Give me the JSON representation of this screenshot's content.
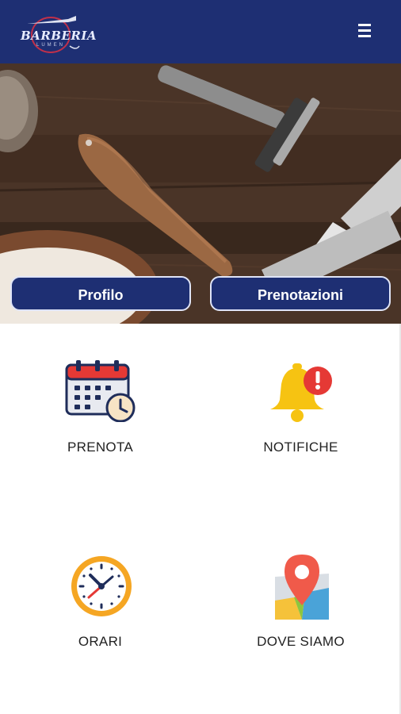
{
  "header": {
    "logo_text": "BARBERIA",
    "logo_sub": "LUMEN",
    "menu_icon": "hamburger-menu-icon"
  },
  "hero": {
    "profile_button": "Profilo",
    "bookings_button": "Prenotazioni"
  },
  "tiles": [
    {
      "label": "PRENOTA",
      "icon": "calendar-clock-icon"
    },
    {
      "label": "NOTIFICHE",
      "icon": "bell-alert-icon"
    },
    {
      "label": "ORARI",
      "icon": "clock-icon"
    },
    {
      "label": "DOVE SIAMO",
      "icon": "map-pin-icon"
    }
  ],
  "colors": {
    "header_bg": "#1e2f73",
    "button_bg": "#1e2f73",
    "bell": "#f6c312",
    "alert": "#e53935",
    "clock_ring": "#f5a623"
  }
}
